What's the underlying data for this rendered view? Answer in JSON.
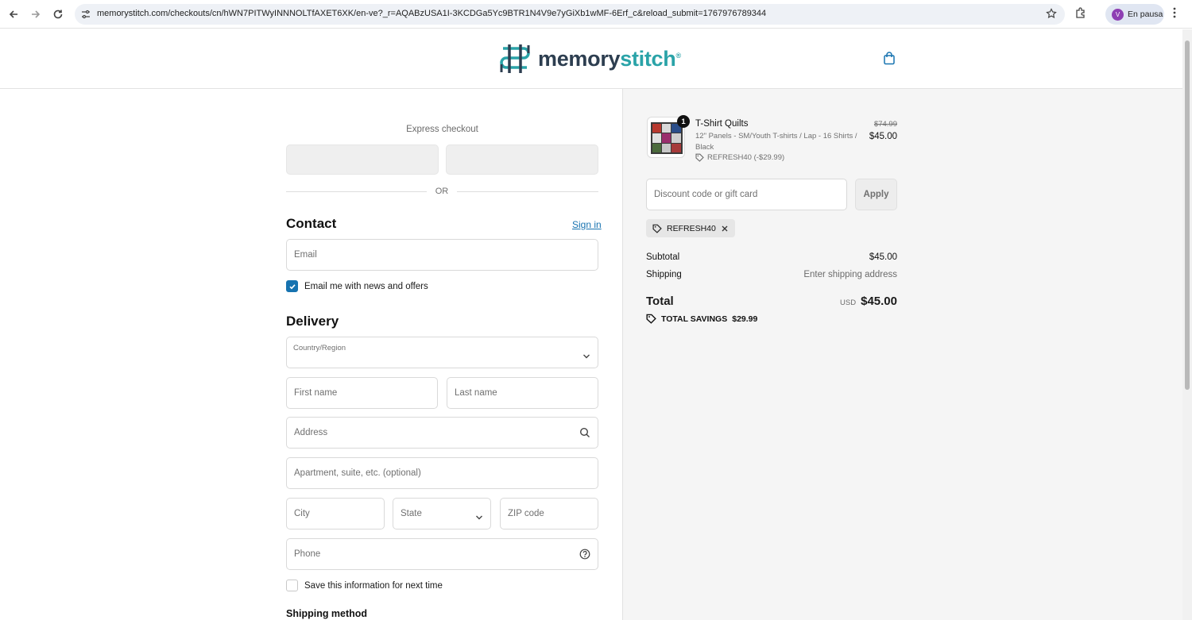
{
  "browser": {
    "url": "memorystitch.com/checkouts/cn/hWN7PITWyINNNOLTfAXET6XK/en-ve?_r=AQABzUSA1I-3KCDGa5Yc9BTR1N4V9e7yGiXb1wMF-6Erf_c&reload_submit=1767976789344",
    "profile_initial": "V",
    "profile_label": "En pausa"
  },
  "store": {
    "logo_memory": "memory",
    "logo_stitch": "stitch",
    "logo_mark": "®"
  },
  "express": {
    "title": "Express checkout",
    "or": "OR"
  },
  "contact": {
    "heading": "Contact",
    "sign_in": "Sign in",
    "email_placeholder": "Email",
    "news_label": "Email me with news and offers"
  },
  "delivery": {
    "heading": "Delivery",
    "country_label": "Country/Region",
    "first_name": "First name",
    "last_name": "Last name",
    "address": "Address",
    "apartment": "Apartment, suite, etc. (optional)",
    "city": "City",
    "state": "State",
    "zip": "ZIP code",
    "phone": "Phone",
    "save_info": "Save this information for next time",
    "shipping_method": "Shipping method"
  },
  "summary": {
    "item": {
      "quantity": "1",
      "name": "T-Shirt Quilts",
      "variant": "12\" Panels - SM/Youth T-shirts / Lap - 16 Shirts / Black",
      "discount": "REFRESH40 (-$29.99)",
      "original_price": "$74.99",
      "price": "$45.00"
    },
    "discount_placeholder": "Discount code or gift card",
    "apply": "Apply",
    "applied_code": "REFRESH40",
    "subtotal_label": "Subtotal",
    "subtotal_value": "$45.00",
    "shipping_label": "Shipping",
    "shipping_value": "Enter shipping address",
    "total_label": "Total",
    "currency": "USD",
    "total_value": "$45.00",
    "savings_label": "TOTAL SAVINGS",
    "savings_value": "$29.99"
  },
  "colors": {
    "link": "#1773b0",
    "brand_dark": "#2d3e50",
    "brand_teal": "#2aa3a8"
  }
}
